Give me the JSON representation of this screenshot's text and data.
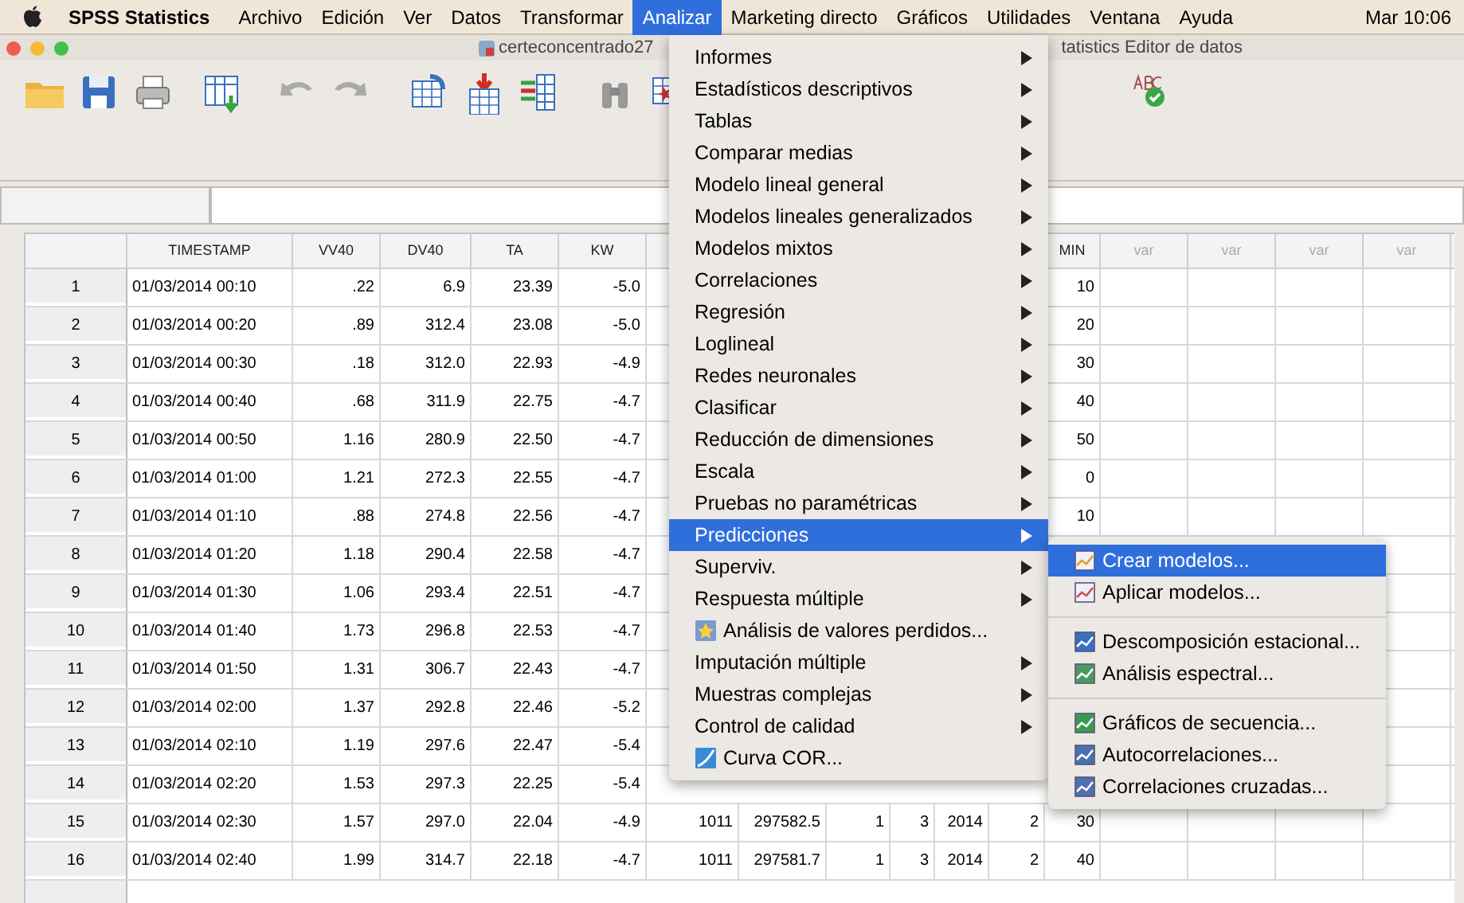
{
  "menu_bar": {
    "app_name": "SPSS Statistics",
    "items": [
      {
        "label": "Archivo",
        "selected": false
      },
      {
        "label": "Edición",
        "selected": false
      },
      {
        "label": "Ver",
        "selected": false
      },
      {
        "label": "Datos",
        "selected": false
      },
      {
        "label": "Transformar",
        "selected": false
      },
      {
        "label": "Analizar",
        "selected": true
      },
      {
        "label": "Marketing directo",
        "selected": false
      },
      {
        "label": "Gráficos",
        "selected": false
      },
      {
        "label": "Utilidades",
        "selected": false
      },
      {
        "label": "Ventana",
        "selected": false
      },
      {
        "label": "Ayuda",
        "selected": false
      }
    ],
    "clock": "Mar 10:06"
  },
  "window": {
    "title": "certeconcentrado27",
    "title_right": "tatistics Editor de datos"
  },
  "table": {
    "columns": [
      {
        "label": "TIMESTAMP",
        "kind": "variable"
      },
      {
        "label": "VV40",
        "kind": "variable"
      },
      {
        "label": "DV40",
        "kind": "variable"
      },
      {
        "label": "TA",
        "kind": "variable"
      },
      {
        "label": "KW",
        "kind": "variable"
      },
      null,
      null,
      null,
      null,
      null,
      null,
      {
        "label": "MIN",
        "kind": "variable"
      },
      {
        "label": "var",
        "kind": "empty"
      },
      {
        "label": "var",
        "kind": "empty"
      },
      {
        "label": "var",
        "kind": "empty"
      },
      {
        "label": "var",
        "kind": "empty"
      }
    ],
    "rows": [
      {
        "number": "1",
        "cells": [
          "01/03/2014 00:10",
          ".22",
          "6.9",
          "23.39",
          "-5.0",
          null,
          null,
          null,
          null,
          null,
          null,
          "10"
        ]
      },
      {
        "number": "2",
        "cells": [
          "01/03/2014 00:20",
          ".89",
          "312.4",
          "23.08",
          "-5.0",
          null,
          null,
          null,
          null,
          null,
          null,
          "20"
        ]
      },
      {
        "number": "3",
        "cells": [
          "01/03/2014 00:30",
          ".18",
          "312.0",
          "22.93",
          "-4.9",
          null,
          null,
          null,
          null,
          null,
          null,
          "30"
        ]
      },
      {
        "number": "4",
        "cells": [
          "01/03/2014 00:40",
          ".68",
          "311.9",
          "22.75",
          "-4.7",
          null,
          null,
          null,
          null,
          null,
          null,
          "40"
        ]
      },
      {
        "number": "5",
        "cells": [
          "01/03/2014 00:50",
          "1.16",
          "280.9",
          "22.50",
          "-4.7",
          null,
          null,
          null,
          null,
          null,
          null,
          "50"
        ]
      },
      {
        "number": "6",
        "cells": [
          "01/03/2014 01:00",
          "1.21",
          "272.3",
          "22.55",
          "-4.7",
          null,
          null,
          null,
          null,
          null,
          null,
          "0"
        ]
      },
      {
        "number": "7",
        "cells": [
          "01/03/2014 01:10",
          ".88",
          "274.8",
          "22.56",
          "-4.7",
          null,
          null,
          null,
          null,
          null,
          null,
          "10"
        ]
      },
      {
        "number": "8",
        "cells": [
          "01/03/2014 01:20",
          "1.18",
          "290.4",
          "22.58",
          "-4.7",
          null,
          null,
          null,
          null,
          null,
          null,
          null
        ]
      },
      {
        "number": "9",
        "cells": [
          "01/03/2014 01:30",
          "1.06",
          "293.4",
          "22.51",
          "-4.7",
          null,
          null,
          null,
          null,
          null,
          null,
          null
        ]
      },
      {
        "number": "10",
        "cells": [
          "01/03/2014 01:40",
          "1.73",
          "296.8",
          "22.53",
          "-4.7",
          null,
          null,
          null,
          null,
          null,
          null,
          null
        ]
      },
      {
        "number": "11",
        "cells": [
          "01/03/2014 01:50",
          "1.31",
          "306.7",
          "22.43",
          "-4.7",
          null,
          null,
          null,
          null,
          null,
          null,
          null
        ]
      },
      {
        "number": "12",
        "cells": [
          "01/03/2014 02:00",
          "1.37",
          "292.8",
          "22.46",
          "-5.2",
          null,
          null,
          null,
          null,
          null,
          null,
          null
        ]
      },
      {
        "number": "13",
        "cells": [
          "01/03/2014 02:10",
          "1.19",
          "297.6",
          "22.47",
          "-5.4",
          null,
          null,
          null,
          null,
          null,
          null,
          null
        ]
      },
      {
        "number": "14",
        "cells": [
          "01/03/2014 02:20",
          "1.53",
          "297.3",
          "22.25",
          "-5.4",
          null,
          null,
          null,
          null,
          null,
          null,
          null
        ]
      },
      {
        "number": "15",
        "cells": [
          "01/03/2014 02:30",
          "1.57",
          "297.0",
          "22.04",
          "-4.9",
          "1011",
          "297582.5",
          "1",
          "3",
          "2014",
          "2",
          "30"
        ]
      },
      {
        "number": "16",
        "cells": [
          "01/03/2014 02:40",
          "1.99",
          "314.7",
          "22.18",
          "-4.7",
          "1011",
          "297581.7",
          "1",
          "3",
          "2014",
          "2",
          "40"
        ]
      }
    ]
  },
  "menu": {
    "items": [
      {
        "label": "Informes",
        "kind": "submenu",
        "selected": false
      },
      {
        "label": "Estadísticos descriptivos",
        "kind": "submenu",
        "selected": false
      },
      {
        "label": "Tablas",
        "kind": "submenu",
        "selected": false
      },
      {
        "label": "Comparar medias",
        "kind": "submenu",
        "selected": false
      },
      {
        "label": "Modelo lineal general",
        "kind": "submenu",
        "selected": false
      },
      {
        "label": "Modelos lineales generalizados",
        "kind": "submenu",
        "selected": false
      },
      {
        "label": "Modelos mixtos",
        "kind": "submenu",
        "selected": false
      },
      {
        "label": "Correlaciones",
        "kind": "submenu",
        "selected": false
      },
      {
        "label": "Regresión",
        "kind": "submenu",
        "selected": false
      },
      {
        "label": "Loglineal",
        "kind": "submenu",
        "selected": false
      },
      {
        "label": "Redes neuronales",
        "kind": "submenu",
        "selected": false
      },
      {
        "label": "Clasificar",
        "kind": "submenu",
        "selected": false
      },
      {
        "label": "Reducción de dimensiones",
        "kind": "submenu",
        "selected": false
      },
      {
        "label": "Escala",
        "kind": "submenu",
        "selected": false
      },
      {
        "label": "Pruebas no paramétricas",
        "kind": "submenu",
        "selected": false
      },
      {
        "label": "Predicciones",
        "kind": "submenu",
        "selected": true
      },
      {
        "label": "Superviv.",
        "kind": "submenu",
        "selected": false
      },
      {
        "label": "Respuesta múltiple",
        "kind": "submenu",
        "selected": false
      },
      {
        "label": "Análisis de valores perdidos...",
        "kind": "command",
        "selected": false
      },
      {
        "label": "Imputación múltiple",
        "kind": "submenu",
        "selected": false
      },
      {
        "label": "Muestras complejas",
        "kind": "submenu",
        "selected": false
      },
      {
        "label": "Control de calidad",
        "kind": "submenu",
        "selected": false
      },
      {
        "label": "Curva COR...",
        "kind": "command",
        "selected": false
      }
    ]
  },
  "submenu": {
    "groups": [
      [
        {
          "label": "Crear modelos...",
          "selected": true
        },
        {
          "label": "Aplicar modelos...",
          "selected": false
        }
      ],
      [
        {
          "label": "Descomposición estacional...",
          "selected": false
        },
        {
          "label": "Análisis espectral...",
          "selected": false
        }
      ],
      [
        {
          "label": "Gráficos de secuencia...",
          "selected": false
        },
        {
          "label": "Autocorrelaciones...",
          "selected": false
        },
        {
          "label": "Correlaciones cruzadas...",
          "selected": false
        }
      ]
    ]
  }
}
